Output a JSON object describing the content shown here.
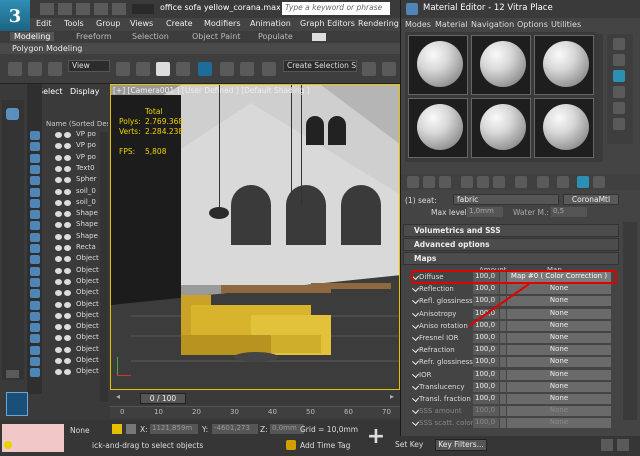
{
  "app": {
    "logo_text": "3",
    "doc_title": "office sofa yellow_corana.max",
    "search_placeholder": "Type a keyword or phrase"
  },
  "menu": [
    "Edit",
    "Tools",
    "Group",
    "Views",
    "Create",
    "Modifiers",
    "Animation",
    "Graph Editors",
    "Rendering"
  ],
  "ribbon_tabs": [
    "Modeling",
    "Freeform",
    "Selection",
    "Object Paint",
    "Populate"
  ],
  "ribbon_sub": "Polygon Modeling",
  "toolbar": {
    "view_dropdown": "View",
    "selection_set": "Create Selection Se"
  },
  "scene_explorer": {
    "tabs": [
      "Select",
      "Display"
    ],
    "column_header": "Name (Sorted Desce",
    "rows": [
      "VP po",
      "VP po",
      "VP po",
      "Text0",
      "Spher",
      "soil_0",
      "soil_0",
      "Shape",
      "Shape",
      "Shape",
      "Recta",
      "Object",
      "Object",
      "Object",
      "Object",
      "Object",
      "Object",
      "Object",
      "Object",
      "Object",
      "Object",
      "Object"
    ]
  },
  "viewport": {
    "label": "[+] [Camera001 ] [User Defined ] [Default Shading ]",
    "stats_total": "Total",
    "polys_label": "Polys:",
    "polys_value": "2.769.368",
    "verts_label": "Verts:",
    "verts_value": "2.284.238",
    "fps_label": "FPS:",
    "fps_value": "5,808"
  },
  "timeline": {
    "frame": "0 / 100",
    "ticks": [
      "0",
      "10",
      "20",
      "30",
      "40",
      "50",
      "60",
      "70"
    ]
  },
  "status": {
    "selection": "None",
    "hint": "ick-and-drag to select objects",
    "x_label": "X:",
    "x_value": "1121,859m",
    "y_label": "Y:",
    "y_value": "-4601,273",
    "z_label": "Z:",
    "z_value": "0,0mm",
    "grid": "Grid = 10,0mm",
    "add_time_tag": "Add Time Tag"
  },
  "material_editor": {
    "title": "Material Editor - 12 Vitra Place",
    "menu": [
      "Modes",
      "Material",
      "Navigation",
      "Options",
      "Utilities"
    ],
    "seat_label": "(1) seat:",
    "material_name": "fabric",
    "material_type": "CoronaMtl",
    "max_level_label": "Max level:",
    "max_level_value": "1,0mm",
    "water_label": "Water M.:",
    "water_value": "0,5",
    "rollouts": [
      "Volumetrics and SSS",
      "Advanced options",
      "Maps"
    ],
    "col_amount": "Amount",
    "col_map": "Map",
    "maps": [
      {
        "label": "Diffuse",
        "amount": "100,0",
        "map": "Map #0  ( Color Correction )",
        "enabled": true
      },
      {
        "label": "Reflection",
        "amount": "100,0",
        "map": "None",
        "enabled": true
      },
      {
        "label": "Refl. glossiness",
        "amount": "100,0",
        "map": "None",
        "enabled": true
      },
      {
        "label": "Anisotropy",
        "amount": "100,0",
        "map": "None",
        "enabled": true
      },
      {
        "label": "Aniso rotation",
        "amount": "100,0",
        "map": "None",
        "enabled": true
      },
      {
        "label": "Fresnel IOR",
        "amount": "100,0",
        "map": "None",
        "enabled": true
      },
      {
        "label": "Refraction",
        "amount": "100,0",
        "map": "None",
        "enabled": true
      },
      {
        "label": "Refr. glossiness",
        "amount": "100,0",
        "map": "None",
        "enabled": true
      },
      {
        "label": "IOR",
        "amount": "100,0",
        "map": "None",
        "enabled": true
      },
      {
        "label": "Translucency",
        "amount": "100,0",
        "map": "None",
        "enabled": true
      },
      {
        "label": "Transl. fraction",
        "amount": "100,0",
        "map": "None",
        "enabled": true
      },
      {
        "label": "SSS amount",
        "amount": "100,0",
        "map": "None",
        "enabled": false
      },
      {
        "label": "SSS scatt. color",
        "amount": "100,0",
        "map": "None",
        "enabled": false
      }
    ],
    "set_key": "Set Key",
    "key_filters": "Key Filters..."
  },
  "colors": {
    "highlight_red": "#e00000",
    "viewport_border": "#e5c100",
    "sofa_yellow": "#d8b42c",
    "accent_blue": "#2e8fb5"
  }
}
